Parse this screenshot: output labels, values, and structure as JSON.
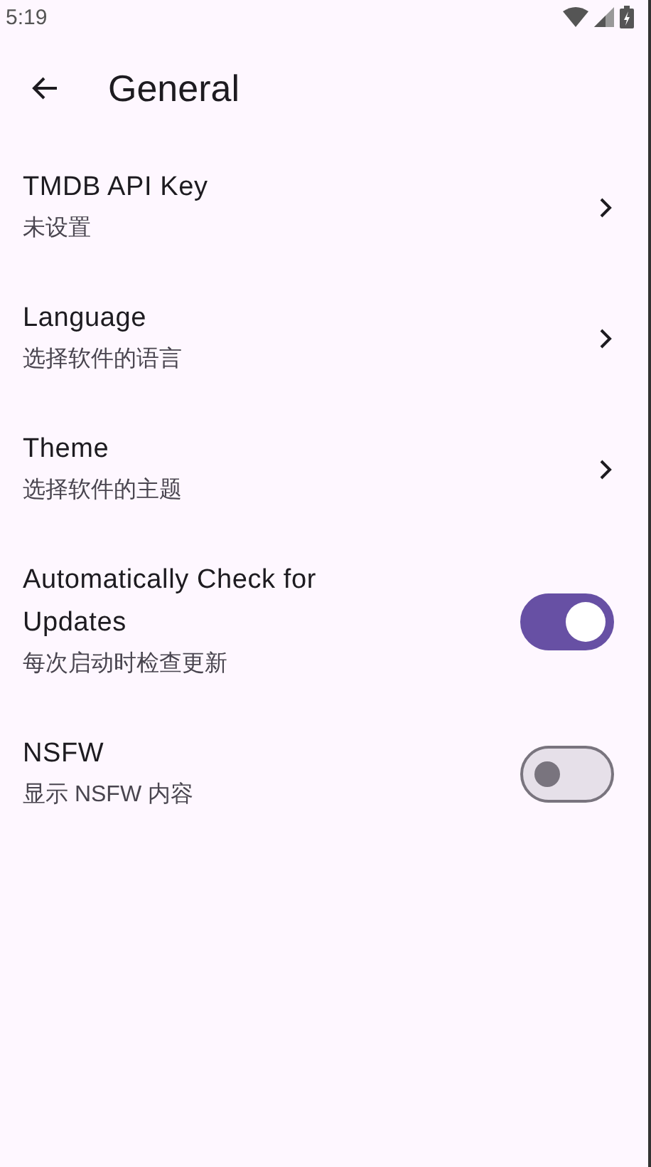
{
  "status_bar": {
    "time": "5:19"
  },
  "app_bar": {
    "title": "General"
  },
  "settings": [
    {
      "kind": "link",
      "title": "TMDB API Key",
      "subtitle": "未设置"
    },
    {
      "kind": "link",
      "title": "Language",
      "subtitle": "选择软件的语言"
    },
    {
      "kind": "link",
      "title": "Theme",
      "subtitle": "选择软件的主题"
    },
    {
      "kind": "switch",
      "title": "Automatically Check for Updates",
      "subtitle": "每次启动时检查更新",
      "on": true
    },
    {
      "kind": "switch",
      "title": "NSFW",
      "subtitle": "显示 NSFW 内容",
      "on": false
    }
  ]
}
